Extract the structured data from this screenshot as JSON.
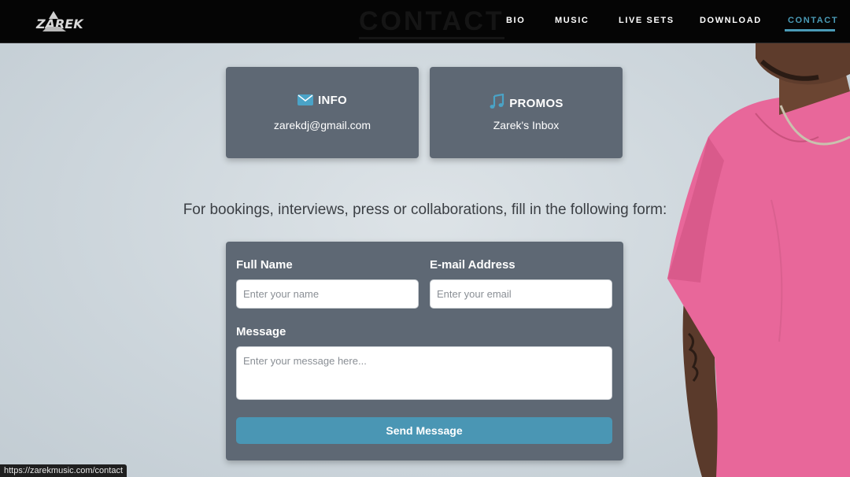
{
  "nav": {
    "logo_text": "ZAREK",
    "ghost_title": "CONTACT",
    "items": [
      {
        "label": "BIO"
      },
      {
        "label": "MUSIC"
      },
      {
        "label": "LIVE SETS"
      },
      {
        "label": "DOWNLOAD"
      },
      {
        "label": "CONTACT",
        "active": true
      }
    ]
  },
  "cards": [
    {
      "title": "INFO",
      "subtitle": "zarekdj@gmail.com",
      "icon": "envelope-icon"
    },
    {
      "title": "PROMOS",
      "subtitle": "Zarek's Inbox",
      "icon": "music-note-icon"
    }
  ],
  "lead_text": "For bookings, interviews, press or collaborations, fill in the following form:",
  "form": {
    "name_label": "Full Name",
    "name_placeholder": "Enter your name",
    "email_label": "E-mail Address",
    "email_placeholder": "Enter your email",
    "message_label": "Message",
    "message_placeholder": "Enter your message here...",
    "submit_label": "Send Message"
  },
  "status_url": "https://zarekmusic.com/contact",
  "colors": {
    "accent": "#4a9bb7",
    "card_bg": "#5e6874",
    "nav_bg": "#050505",
    "shirt": "#e86a9a"
  }
}
